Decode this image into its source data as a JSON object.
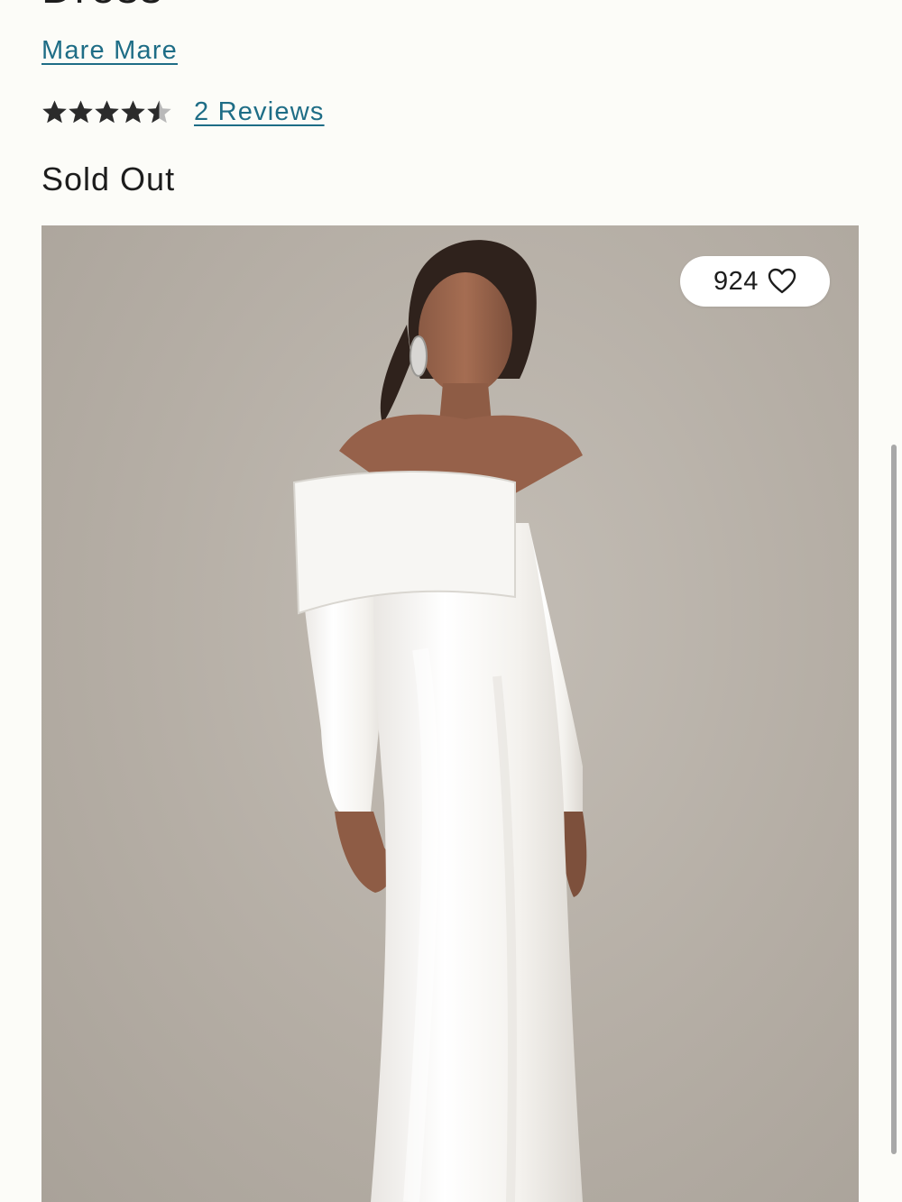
{
  "product": {
    "title": "Dress",
    "brand": "Mare Mare",
    "rating": 4.5,
    "rating_max": 5,
    "reviews_label": "2 Reviews",
    "availability": "Sold Out"
  },
  "image": {
    "alt": "Model wearing white sequin off-the-shoulder long-sleeve gown",
    "background": "#b8b1a8"
  },
  "like": {
    "count": "924",
    "icon": "heart-outline-icon"
  },
  "colors": {
    "link": "#1e6d86",
    "text": "#1d1d1d",
    "page_background": "#fcfcf8"
  }
}
